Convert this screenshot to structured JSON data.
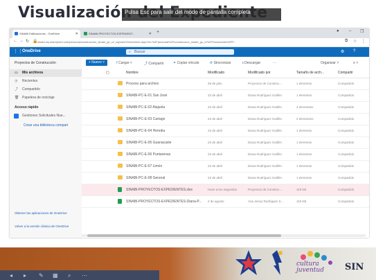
{
  "slide": {
    "title": "Visualización del Expediente",
    "fullscreen_notice": "Pulsa  Esc  para salir del modo de pantalla completa",
    "fullscreen_key": "Esc"
  },
  "browser": {
    "tabs": [
      {
        "label": "SINABI Edificaciones - OneDrive"
      },
      {
        "label": "SINABI-PROYECTOS-EXPEDIENT..."
      }
    ],
    "url": "sinabi-my.sharepoint.com/personal/construccion_sinabi_go_cr/_layouts/15/onedrive.aspx?id=%2Fpersonal%2Fconstruccion_sinabi_go_cr%2FDocuments%2FP..."
  },
  "app": {
    "name": "OneDrive",
    "search_placeholder": "Buscar"
  },
  "leftnav": {
    "header": "Proyectos de Construcción",
    "items": [
      {
        "label": "Mis archivos",
        "icon": "folder-icon",
        "selected": true
      },
      {
        "label": "Recientes",
        "icon": "clock-icon"
      },
      {
        "label": "Compartido",
        "icon": "share-icon"
      },
      {
        "label": "Papelera de reciclaje",
        "icon": "trash-icon"
      }
    ],
    "quick_access_title": "Acceso rápido",
    "quick_items": [
      {
        "label": "Gestiones Solicitudes Nue..."
      }
    ],
    "create_link": "Crear una biblioteca compart",
    "footer_links": [
      "Obtener las aplicaciones de OneDrive",
      "Volver a la versión clásica de OneDrive"
    ]
  },
  "commands": {
    "new": "+ Nuevo ˅",
    "upload": "Cargar ˅",
    "share": "Compartir",
    "copy_link": "Copiar vínculo",
    "sync": "Sincronizar",
    "download": "Descargar",
    "more": "···",
    "sort": "Organizar ˅",
    "view": "≡ ˅"
  },
  "table": {
    "columns": [
      "Nombre",
      "Modificado",
      "Modificado por",
      "Tamaño de arch...",
      "Compartir"
    ],
    "rows": [
      {
        "type": "folder",
        "name": "Proceso para archivo",
        "modified": "28 de julio",
        "by": "Proyectos de Construc...",
        "size": "1 elemento",
        "share": "Compartido"
      },
      {
        "type": "folder",
        "name": "SINABI-PC-E-01 San José",
        "modified": "23 de abril",
        "by": "Diana Rodríguez Guillén",
        "size": "1 elemento",
        "share": "Compartido"
      },
      {
        "type": "folder",
        "name": "SINABI-PC-E-02 Alajuela",
        "modified": "23 de abril",
        "by": "Diana Rodríguez Guillén",
        "size": "4 elementos",
        "share": "Compartido"
      },
      {
        "type": "folder",
        "name": "SINABI-PC-E-03 Cartago",
        "modified": "23 de abril",
        "by": "Diana Rodríguez Guillén",
        "size": "2 elementos",
        "share": "Compartido"
      },
      {
        "type": "folder",
        "name": "SINABI-PC-E-04 Heredia",
        "modified": "23 de abril",
        "by": "Diana Rodríguez Guillén",
        "size": "1 elemento",
        "share": "Compartido"
      },
      {
        "type": "folder",
        "name": "SINABI-PC-E-05 Guanacaste",
        "modified": "23 de abril",
        "by": "Diana Rodríguez Guillén",
        "size": "1 elemento",
        "share": "Compartido"
      },
      {
        "type": "folder",
        "name": "SINABI-PC-E-06 Puntarenas",
        "modified": "23 de abril",
        "by": "Diana Rodríguez Guillén",
        "size": "1 elemento",
        "share": "Compartido"
      },
      {
        "type": "folder",
        "name": "SINABI-PC-E-07 Limón",
        "modified": "23 de abril",
        "by": "Diana Rodríguez Guillén",
        "size": "1 elemento",
        "share": "Compartido"
      },
      {
        "type": "folder",
        "name": "SINABI-PC-E-08 General",
        "modified": "23 de abril",
        "by": "Diana Rodríguez Guillén",
        "size": "1 elemento",
        "share": "Compartido"
      },
      {
        "type": "file",
        "name": "SINABI-PROYECTOS-EXPEDIENTES.xlsx",
        "modified": "Hace unos segundos",
        "by": "Proyectos de Construc...",
        "size": "119 KB",
        "share": "Compartido",
        "highlight": true
      },
      {
        "type": "file",
        "name": "SINABI-PROYECTOS-EXPEDIENTES-Diana-P...",
        "modified": "2 de agosto",
        "by": "Ana Jenny Rodríguez S...",
        "size": "119 KB",
        "share": "Compartido"
      }
    ]
  },
  "footer": {
    "brand_text_1": "cultura",
    "brand_text_2": "juventud",
    "brand_text_3": "SIN"
  }
}
